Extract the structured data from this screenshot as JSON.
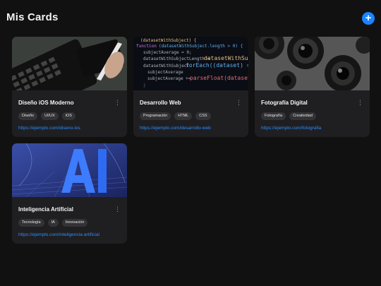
{
  "header": {
    "title": "Mis Cards",
    "add_label": "+",
    "add_icon": "plus-icon"
  },
  "colors": {
    "background": "#111112",
    "card": "#1f1f21",
    "accent": "#1a84ff",
    "tag": "#333336",
    "link": "#2f8cff"
  },
  "cards": [
    {
      "title": "Diseño iOS Moderno",
      "image": "tablet-stylus-photo",
      "tags": [
        "Diseño",
        "UI/UX",
        "iOS"
      ],
      "link": "https://ejemplo.com/diseno-ios",
      "menu_icon": "more-vertical-icon"
    },
    {
      "title": "Desarrollo Web",
      "image": "code-editor-photo",
      "tags": [
        "Programación",
        "HTML",
        "CSS"
      ],
      "link": "https://ejemplo.com/desarrollo-web",
      "menu_icon": "more-vertical-icon"
    },
    {
      "title": "Fotografía Digital",
      "image": "camera-lenses-photo",
      "tags": [
        "Fotografía",
        "Creatividad"
      ],
      "link": "https://ejemplo.com/fotografia",
      "menu_icon": "more-vertical-icon"
    },
    {
      "title": "Inteligencia Artificial",
      "image": "ai-letters-render",
      "tags": [
        "Tecnología",
        "IA",
        "Innovación"
      ],
      "link": "https://ejemplo.com/inteligencia-artificial",
      "menu_icon": "more-vertical-icon"
    }
  ]
}
